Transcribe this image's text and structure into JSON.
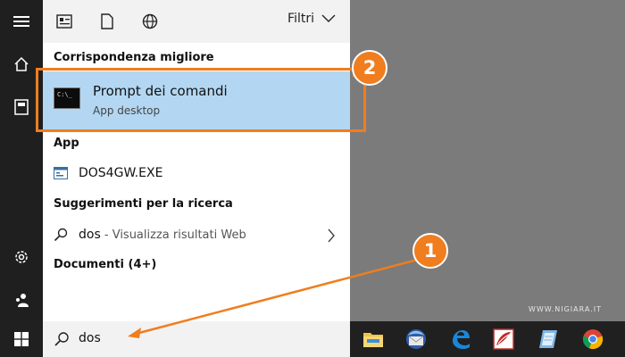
{
  "window": {
    "topbar_icons": [
      "documents-icon",
      "file-icon",
      "globe-icon"
    ],
    "filters_label": "Filtri"
  },
  "sidebar": {
    "items": [
      "hamburger-menu-icon",
      "home-icon",
      "notebook-icon",
      "settings-icon",
      "people-icon"
    ]
  },
  "sections": {
    "best_match_header": "Corrispondenza migliore",
    "apps_header": "App",
    "suggestions_header": "Suggerimenti per la ricerca",
    "documents_header": "Documenti (4+)"
  },
  "best_match": {
    "title": "Prompt dei comandi",
    "subtitle": "App desktop",
    "icon": "cmd-icon"
  },
  "apps": [
    {
      "label": "DOS4GW.EXE",
      "icon": "exe-window-icon"
    }
  ],
  "suggestions": [
    {
      "query": "dos",
      "detail": " - Visualizza risultati Web"
    }
  ],
  "search": {
    "value": "dos"
  },
  "taskbar": {
    "apps": [
      "file-explorer-icon",
      "thunderbird-icon",
      "edge-icon",
      "reader-icon",
      "notepad-icon",
      "chrome-icon"
    ]
  },
  "watermark": "WWW.NIGIARA.IT",
  "annotations": {
    "callout_1": "1",
    "callout_2": "2"
  },
  "colors": {
    "accent": "#f07d1e",
    "selection": "#b3d7f2",
    "taskbar": "#202020"
  }
}
